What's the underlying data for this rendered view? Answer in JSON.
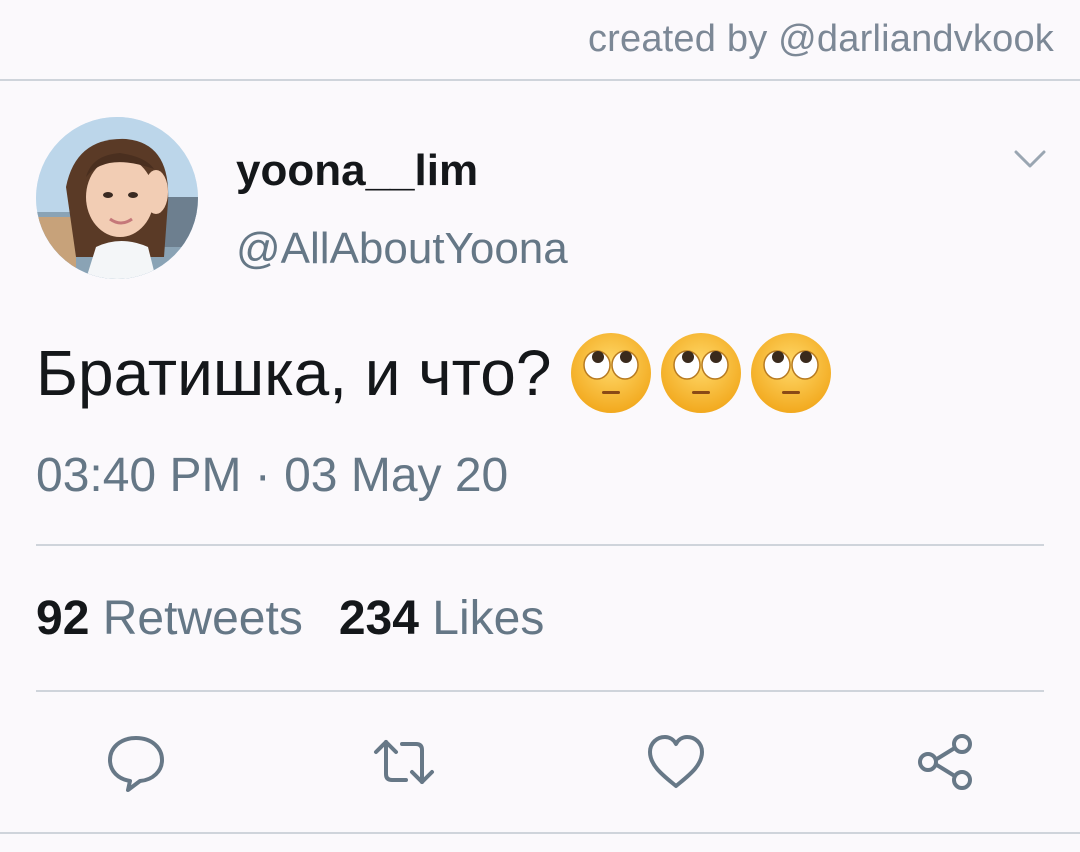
{
  "credit": "created by @darliandvkook",
  "tweet": {
    "display_name": "yoona__lim",
    "handle": "@AllAboutYoona",
    "text": "Братишка, и что?",
    "emojis": [
      "eye-roll-emoji",
      "eye-roll-emoji",
      "eye-roll-emoji"
    ],
    "timestamp": "03:40 PM · 03 May 20",
    "retweets_count": "92",
    "retweets_label": "Retweets",
    "likes_count": "234",
    "likes_label": "Likes"
  },
  "icons": {
    "menu": "chevron-down-icon",
    "reply": "reply-icon",
    "retweet": "retweet-icon",
    "like": "heart-icon",
    "share": "share-icon"
  },
  "colors": {
    "background": "#fbf9fc",
    "text_primary": "#14171a",
    "text_secondary": "#657786",
    "divider": "#cfd4db"
  }
}
